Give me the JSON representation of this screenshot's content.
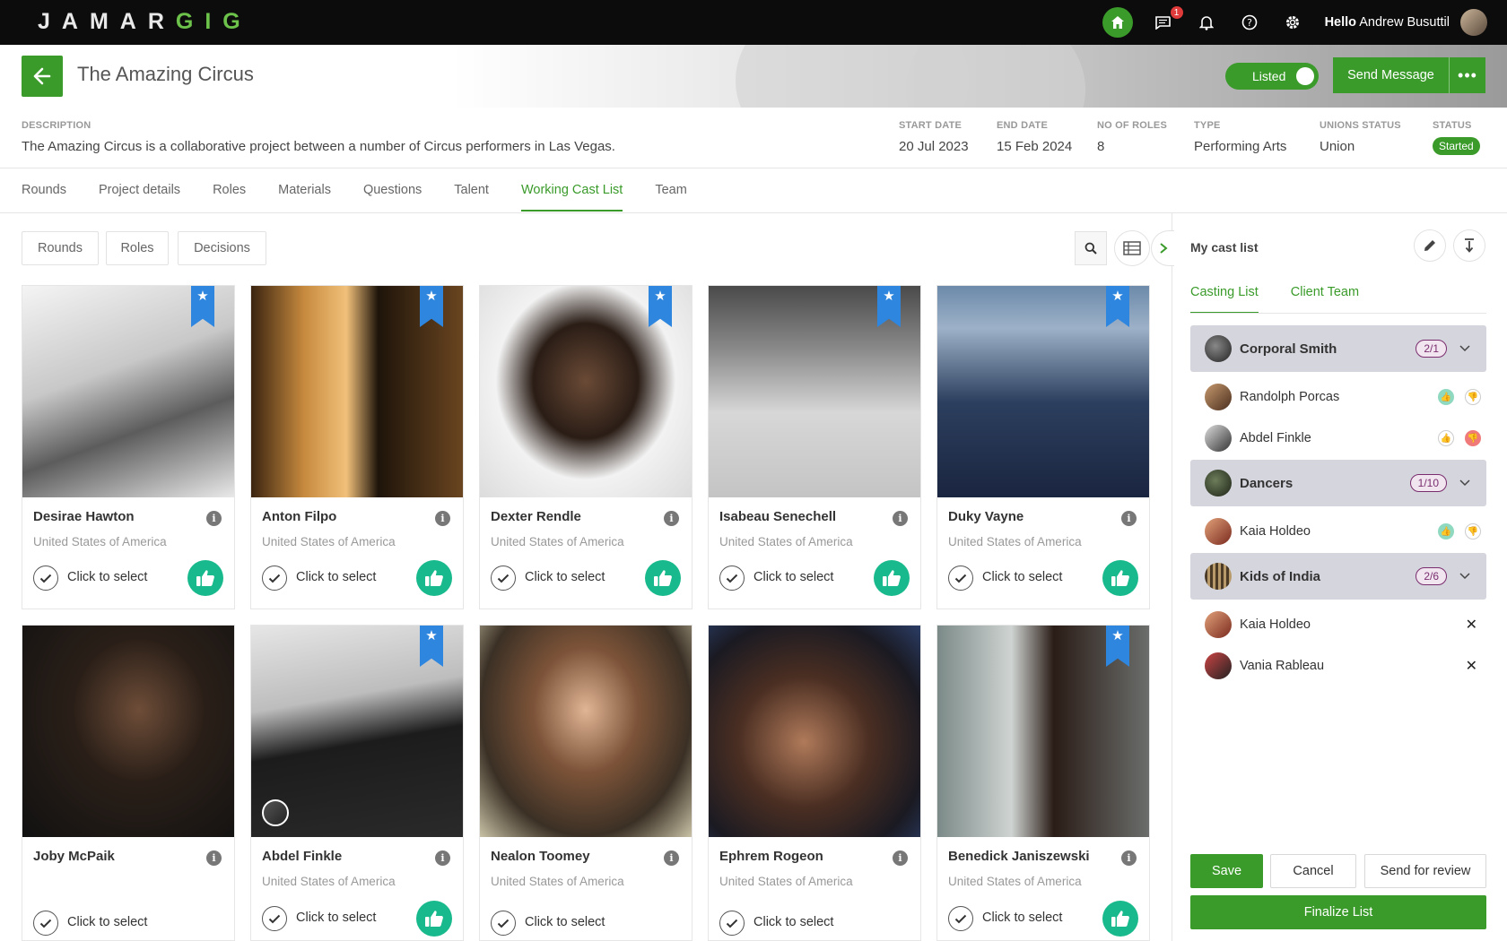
{
  "app": {
    "logo_main": "JAMAR",
    "logo_accent": "GIG"
  },
  "topbar": {
    "notification_count": "1",
    "greeting": "Hello",
    "user_name": "Andrew Busuttil"
  },
  "project": {
    "title": "The Amazing Circus",
    "listed_label": "Listed",
    "send_message_label": "Send Message",
    "description_label": "DESCRIPTION",
    "description": "The Amazing Circus is a collaborative project between a number of Circus performers in Las Vegas.",
    "start_date_label": "START DATE",
    "start_date": "20 Jul 2023",
    "end_date_label": "END DATE",
    "end_date": "15 Feb 2024",
    "roles_label": "NO OF ROLES",
    "roles": "8",
    "type_label": "TYPE",
    "type": "Performing Arts",
    "unions_label": "UNIONS STATUS",
    "unions": "Union",
    "status_label": "STATUS",
    "status": "Started"
  },
  "tabs": [
    "Rounds",
    "Project details",
    "Roles",
    "Materials",
    "Questions",
    "Talent",
    "Working Cast List",
    "Team"
  ],
  "active_tab": "Working Cast List",
  "filters": [
    "Rounds",
    "Roles",
    "Decisions"
  ],
  "select_label": "Click to select",
  "talent": [
    {
      "name": "Desirae Hawton",
      "country": "United States of America",
      "starred": true
    },
    {
      "name": "Anton Filpo",
      "country": "United States of America",
      "starred": true
    },
    {
      "name": "Dexter Rendle",
      "country": "United States of America",
      "starred": true
    },
    {
      "name": "Isabeau Senechell",
      "country": "United States of America",
      "starred": true
    },
    {
      "name": "Duky Vayne",
      "country": "United States of America",
      "starred": true
    },
    {
      "name": "Joby McPaik",
      "country": "",
      "starred": false
    },
    {
      "name": "Abdel Finkle",
      "country": "United States of America",
      "starred": true
    },
    {
      "name": "Nealon Toomey",
      "country": "United States of America",
      "starred": false
    },
    {
      "name": "Ephrem Rogeon",
      "country": "United States of America",
      "starred": false
    },
    {
      "name": "Benedick Janiszewski",
      "country": "United States of America",
      "starred": true
    }
  ],
  "cast_panel": {
    "title": "My cast list",
    "tabs": [
      "Casting List",
      "Client Team"
    ],
    "groups": [
      {
        "name": "Corporal Smith",
        "count": "2/1",
        "members": [
          "Randolph Porcas",
          "Abdel Finkle"
        ]
      },
      {
        "name": "Dancers",
        "count": "1/10",
        "members": [
          "Kaia Holdeo"
        ]
      },
      {
        "name": "Kids of India",
        "count": "2/6",
        "members": [
          "Kaia Holdeo",
          "Vania Rableau"
        ]
      }
    ],
    "save_label": "Save",
    "cancel_label": "Cancel",
    "review_label": "Send for review",
    "finalize_label": "Finalize List"
  },
  "colors": {
    "brand_green": "#3a9b2a",
    "thumb_teal": "#18b98c",
    "ribbon_blue": "#2e86de",
    "count_purple": "#7a2d6e"
  }
}
